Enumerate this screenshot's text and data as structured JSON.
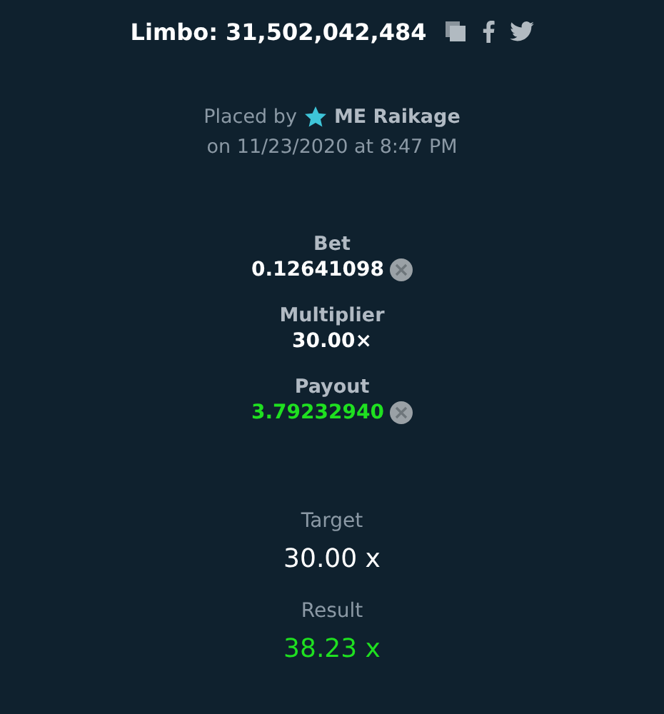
{
  "title": "Limbo: 31,502,042,484",
  "placed": {
    "prefix": "Placed by",
    "user": "ME Raikage",
    "date": "on 11/23/2020 at 8:47 PM"
  },
  "stats": [
    {
      "label": "Bet",
      "value": "0.12641098",
      "coin": true,
      "positive": false
    },
    {
      "label": "Multiplier",
      "value": "30.00×",
      "coin": false,
      "positive": false
    },
    {
      "label": "Payout",
      "value": "3.79232940",
      "coin": true,
      "positive": true
    }
  ],
  "outcome": [
    {
      "label": "Target",
      "value": "30.00 x",
      "positive": false
    },
    {
      "label": "Result",
      "value": "38.23 x",
      "positive": true
    }
  ]
}
